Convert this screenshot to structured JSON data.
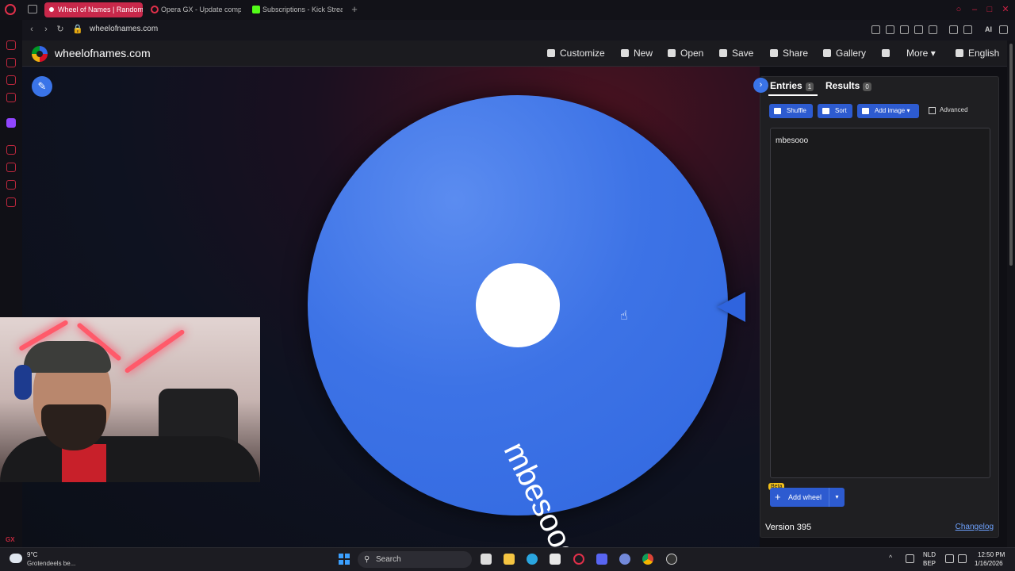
{
  "browser": {
    "tabs": [
      {
        "label": "Wheel of Names | Random",
        "active": true
      },
      {
        "label": "Opera GX - Update comp",
        "active": false
      },
      {
        "label": "Subscriptions - Kick Strea",
        "active": false
      }
    ],
    "url": "wheelofnames.com",
    "ai_label": "AI"
  },
  "site": {
    "name": "wheelofnames.com",
    "nav": {
      "customize": "Customize",
      "new": "New",
      "open": "Open",
      "save": "Save",
      "share": "Share",
      "gallery": "Gallery",
      "more": "More",
      "language": "English"
    }
  },
  "wheel": {
    "entry_label": "mbesooo",
    "color": "#3d73e6"
  },
  "panel": {
    "tabs": {
      "entries": {
        "label": "Entries",
        "count": "1"
      },
      "results": {
        "label": "Results",
        "count": "0"
      }
    },
    "buttons": {
      "shuffle": "Shuffle",
      "sort": "Sort",
      "add_image": "Add image",
      "advanced": "Advanced"
    },
    "entries": [
      "mbesooo"
    ],
    "beta": "Beta",
    "add_wheel": "Add wheel",
    "version": "Version 395",
    "changelog": "Changelog"
  },
  "taskbar": {
    "weather_temp": "9°C",
    "weather_desc": "Grotendeels be...",
    "search_placeholder": "Search",
    "lang_top": "NLD",
    "lang_bottom": "BEP",
    "time": "12:50 PM",
    "date": "1/16/2026"
  },
  "colors": {
    "accent": "#2d5bd0",
    "opera_red": "#c8284a"
  }
}
